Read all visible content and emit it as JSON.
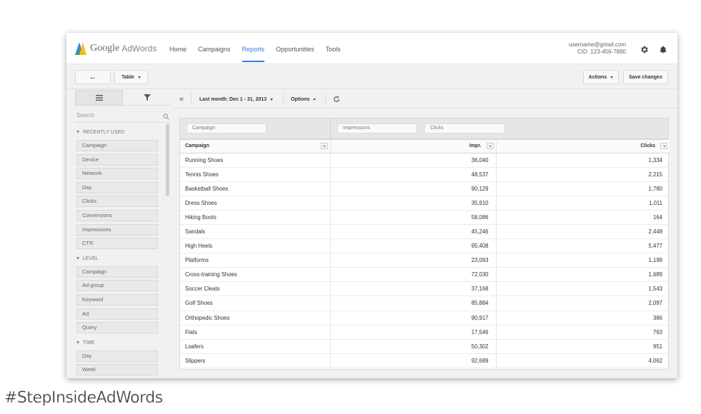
{
  "brand": {
    "google": "Google",
    "adwords": "AdWords"
  },
  "nav": [
    "Home",
    "Campaigns",
    "Reports",
    "Opportunities",
    "Tools"
  ],
  "nav_active": "Reports",
  "account": {
    "email": "username@gmail.com",
    "cid": "CID: 123-456-7890"
  },
  "toolbar": {
    "view_label": "Table",
    "actions_label": "Actions",
    "save_label": "Save changes"
  },
  "left_panel": {
    "search_placeholder": "Search",
    "sections": [
      {
        "title": "RECENTLY USED",
        "items": [
          "Campaign",
          "Device",
          "Network",
          "Day",
          "Clicks",
          "Conversions",
          "Impressions",
          "CTR"
        ]
      },
      {
        "title": "LEVEL",
        "items": [
          "Campaign",
          "Ad group",
          "Keyword",
          "Ad",
          "Query"
        ]
      },
      {
        "title": "TIME",
        "items": [
          "Day",
          "Week"
        ]
      }
    ]
  },
  "filterbar": {
    "date_range": "Last month: Dec 1 - 31, 2013",
    "options": "Options"
  },
  "pivot": {
    "rows_chip": "Campaign",
    "values_chip_1": "Impressions",
    "values_chip_2": "Clicks"
  },
  "table": {
    "headers": [
      "Campaign",
      "Impr.",
      "Clicks"
    ],
    "rows": [
      [
        "Running Shoes",
        "36,040",
        "1,334"
      ],
      [
        "Tennis Shoes",
        "48,537",
        "2,215"
      ],
      [
        "Basketball Shoes",
        "90,129",
        "1,780"
      ],
      [
        "Dress Shoes",
        "35,910",
        "1,011"
      ],
      [
        "Hiking Boots",
        "58,086",
        "164"
      ],
      [
        "Sandals",
        "45,246",
        "2,449"
      ],
      [
        "High Heels",
        "95,408",
        "5,477"
      ],
      [
        "Platforms",
        "23,093",
        "1,199"
      ],
      [
        "Cross-training Shoes",
        "72,030",
        "1,689"
      ],
      [
        "Soccer Cleats",
        "37,168",
        "1,543"
      ],
      [
        "Golf Shoes",
        "85,884",
        "2,097"
      ],
      [
        "Orthopedic Shoes",
        "90,917",
        "386"
      ],
      [
        "Flats",
        "17,546",
        "763"
      ],
      [
        "Loafers",
        "50,302",
        "951"
      ],
      [
        "Slippers",
        "92,689",
        "4,062"
      ]
    ]
  },
  "caption": "#StepInsideAdWords",
  "colors": {
    "accent": "#3b78e7",
    "logo_blue": "#4285f4",
    "logo_yellow": "#fbbc05",
    "logo_green": "#34a853"
  }
}
